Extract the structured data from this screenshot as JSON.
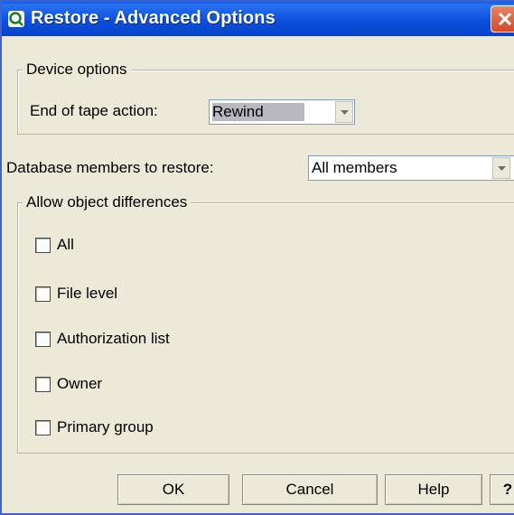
{
  "window": {
    "title": "Restore - Advanced Options"
  },
  "device_options": {
    "legend": "Device options",
    "end_of_tape_label": "End of tape action:",
    "end_of_tape_value": "Rewind"
  },
  "database": {
    "label": "Database members to restore:",
    "value": "All members"
  },
  "differences": {
    "legend": "Allow object differences",
    "items": [
      {
        "label": "All",
        "checked": false
      },
      {
        "label": "File level",
        "checked": false
      },
      {
        "label": "Authorization list",
        "checked": false
      },
      {
        "label": "Owner",
        "checked": false
      },
      {
        "label": "Primary group",
        "checked": false
      }
    ]
  },
  "buttons": {
    "ok": "OK",
    "cancel": "Cancel",
    "help": "Help",
    "whats_this": "?"
  },
  "colors": {
    "titlebar": "#0b4fdc",
    "dialog_bg": "#ece9d8",
    "close": "#d44b2a"
  }
}
